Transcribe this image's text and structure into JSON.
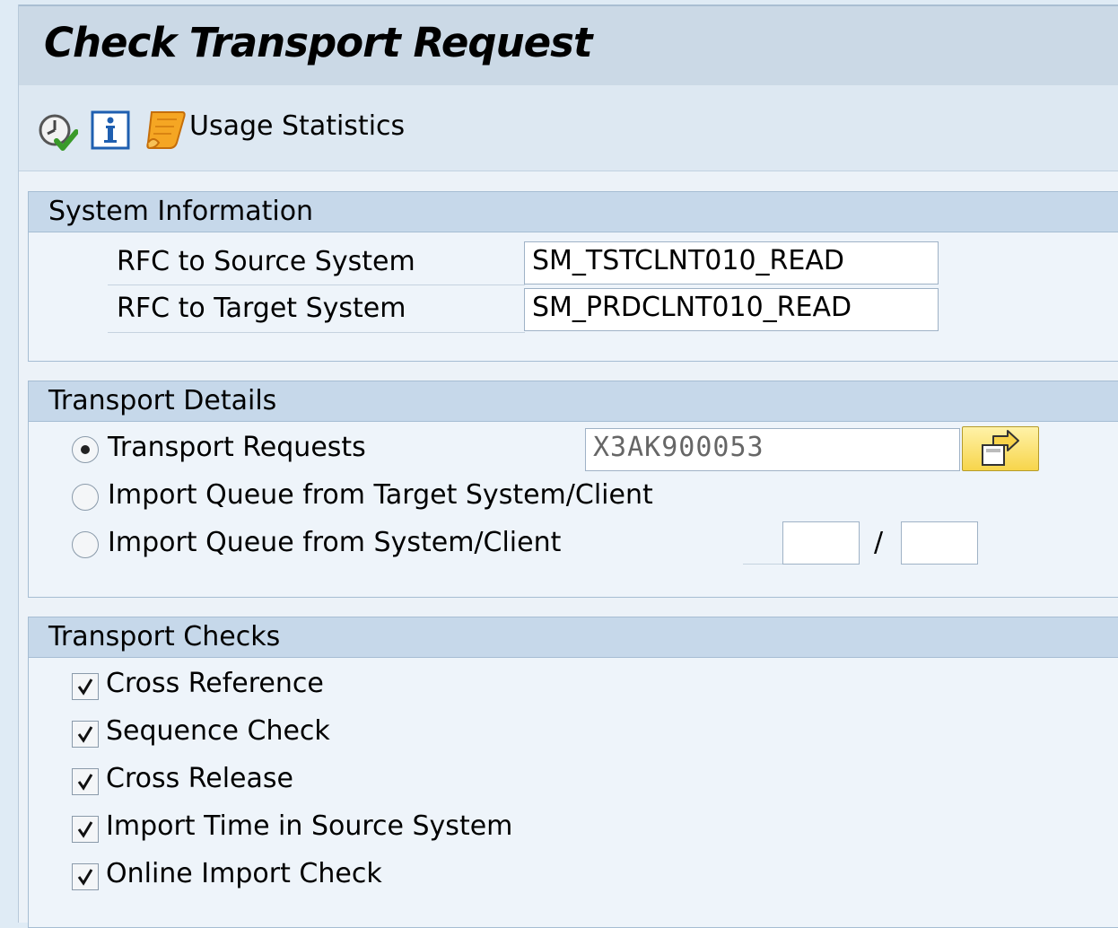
{
  "window": {
    "title": "Check Transport Request"
  },
  "toolbar": {
    "execute_icon": "execute-clock-check-icon",
    "info_icon": "info-icon",
    "usage_icon": "scroll-icon",
    "usage_label": "Usage Statistics"
  },
  "system_information": {
    "title": "System Information",
    "rows": [
      {
        "label": "RFC to Source System",
        "value": "SM_TSTCLNT010_READ"
      },
      {
        "label": "RFC to Target System",
        "value": "SM_PRDCLNT010_READ"
      }
    ]
  },
  "transport_details": {
    "title": "Transport Details",
    "options": [
      {
        "label": "Transport Requests",
        "selected": true
      },
      {
        "label": "Import Queue from Target System/Client",
        "selected": false
      },
      {
        "label": "Import Queue from System/Client",
        "selected": false
      }
    ],
    "request_value": "X3AK900053",
    "separator": "/",
    "system_value": "",
    "client_value": ""
  },
  "transport_checks": {
    "title": "Transport Checks",
    "items": [
      {
        "label": "Cross Reference",
        "checked": true
      },
      {
        "label": "Sequence Check",
        "checked": true
      },
      {
        "label": "Cross Release",
        "checked": true
      },
      {
        "label": "Import Time in Source System",
        "checked": true
      },
      {
        "label": "Online Import Check",
        "checked": true
      }
    ]
  },
  "colors": {
    "header_bg": "#cbd9e6",
    "group_header_bg": "#c6d8ea",
    "yellow_button": "#f7d54b"
  }
}
